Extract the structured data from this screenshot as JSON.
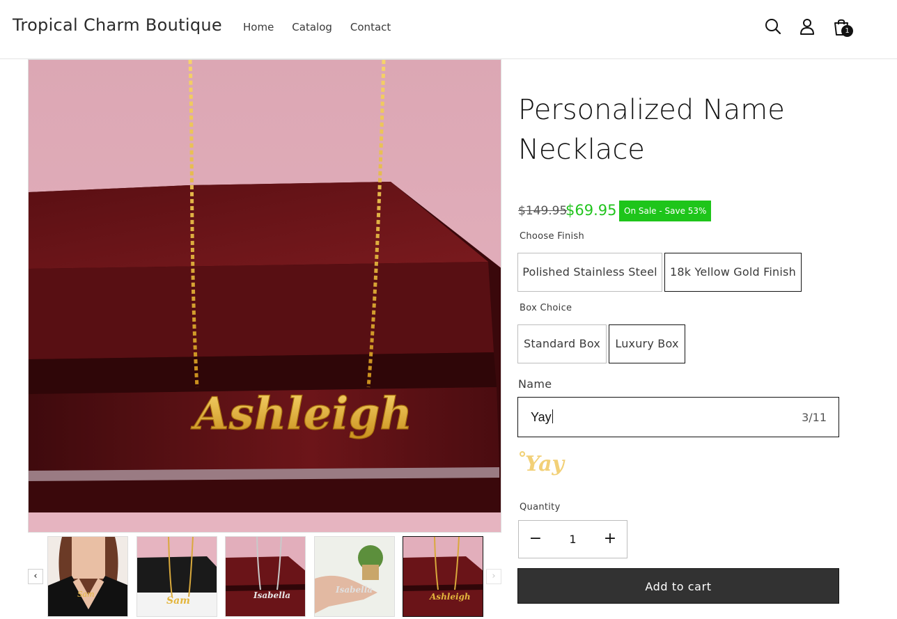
{
  "store": {
    "name": "Tropical Charm Boutique"
  },
  "nav": {
    "items": [
      {
        "label": "Home"
      },
      {
        "label": "Catalog"
      },
      {
        "label": "Contact"
      }
    ]
  },
  "header": {
    "cart_count": "1"
  },
  "product": {
    "title": "Personalized Name Necklace",
    "price_original": "$149.95",
    "price_sale": "$69.95",
    "sale_badge": "On Sale - Save 53%",
    "main_image_name": "Ashleigh",
    "options": {
      "finish": {
        "label": "Choose Finish",
        "values": [
          "Polished Stainless Steel",
          "18k Yellow Gold Finish"
        ],
        "selected": "18k Yellow Gold Finish"
      },
      "box": {
        "label": "Box Choice",
        "values": [
          "Standard Box",
          "Luxury Box"
        ],
        "selected": "Luxury Box"
      }
    },
    "name_field": {
      "label": "Name",
      "value": "Yay",
      "counter": "3/11",
      "preview": "Yay"
    },
    "quantity": {
      "label": "Quantity",
      "value": "1",
      "minus": "−",
      "plus": "+"
    },
    "add_to_cart": "Add to cart",
    "thumbnails": [
      {
        "engraving": "Sam"
      },
      {
        "engraving": "Isabella"
      },
      {
        "engraving": "Isabella"
      },
      {
        "engraving": "Ashleigh"
      }
    ]
  },
  "gallery": {
    "prev": "‹",
    "next": "›"
  },
  "colors": {
    "sale_green": "#22c41e",
    "badge_green": "#1ec51a",
    "gold": "#e3b53c",
    "button_dark": "#323232"
  },
  "icons": {
    "search": "search-icon",
    "account": "account-icon",
    "cart": "cart-icon"
  }
}
